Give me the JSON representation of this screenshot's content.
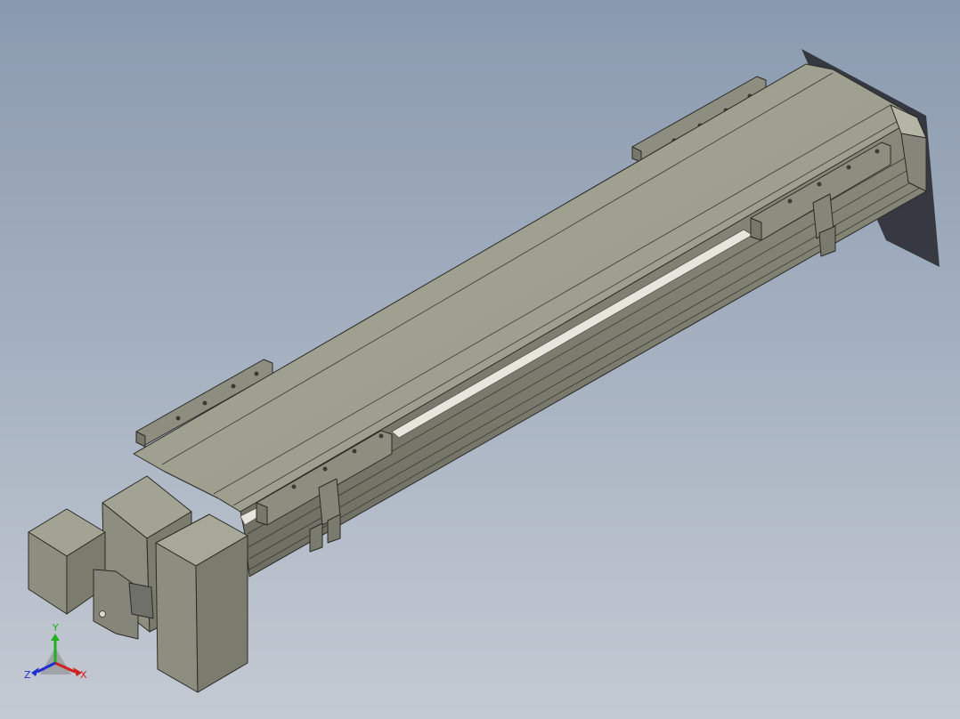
{
  "viewport": {
    "background_top": "#8a9aae",
    "background_bottom": "#c4cad3"
  },
  "model": {
    "body_color": "#9a9a8a",
    "top_color": "#a3a393",
    "side_color": "#7c7c6e",
    "rail_color": "#e6e6dc"
  },
  "triad": {
    "x_label": "X",
    "y_label": "Y",
    "z_label": "Z",
    "x_color": "#d02020",
    "y_color": "#20b020",
    "z_color": "#2030d0"
  }
}
